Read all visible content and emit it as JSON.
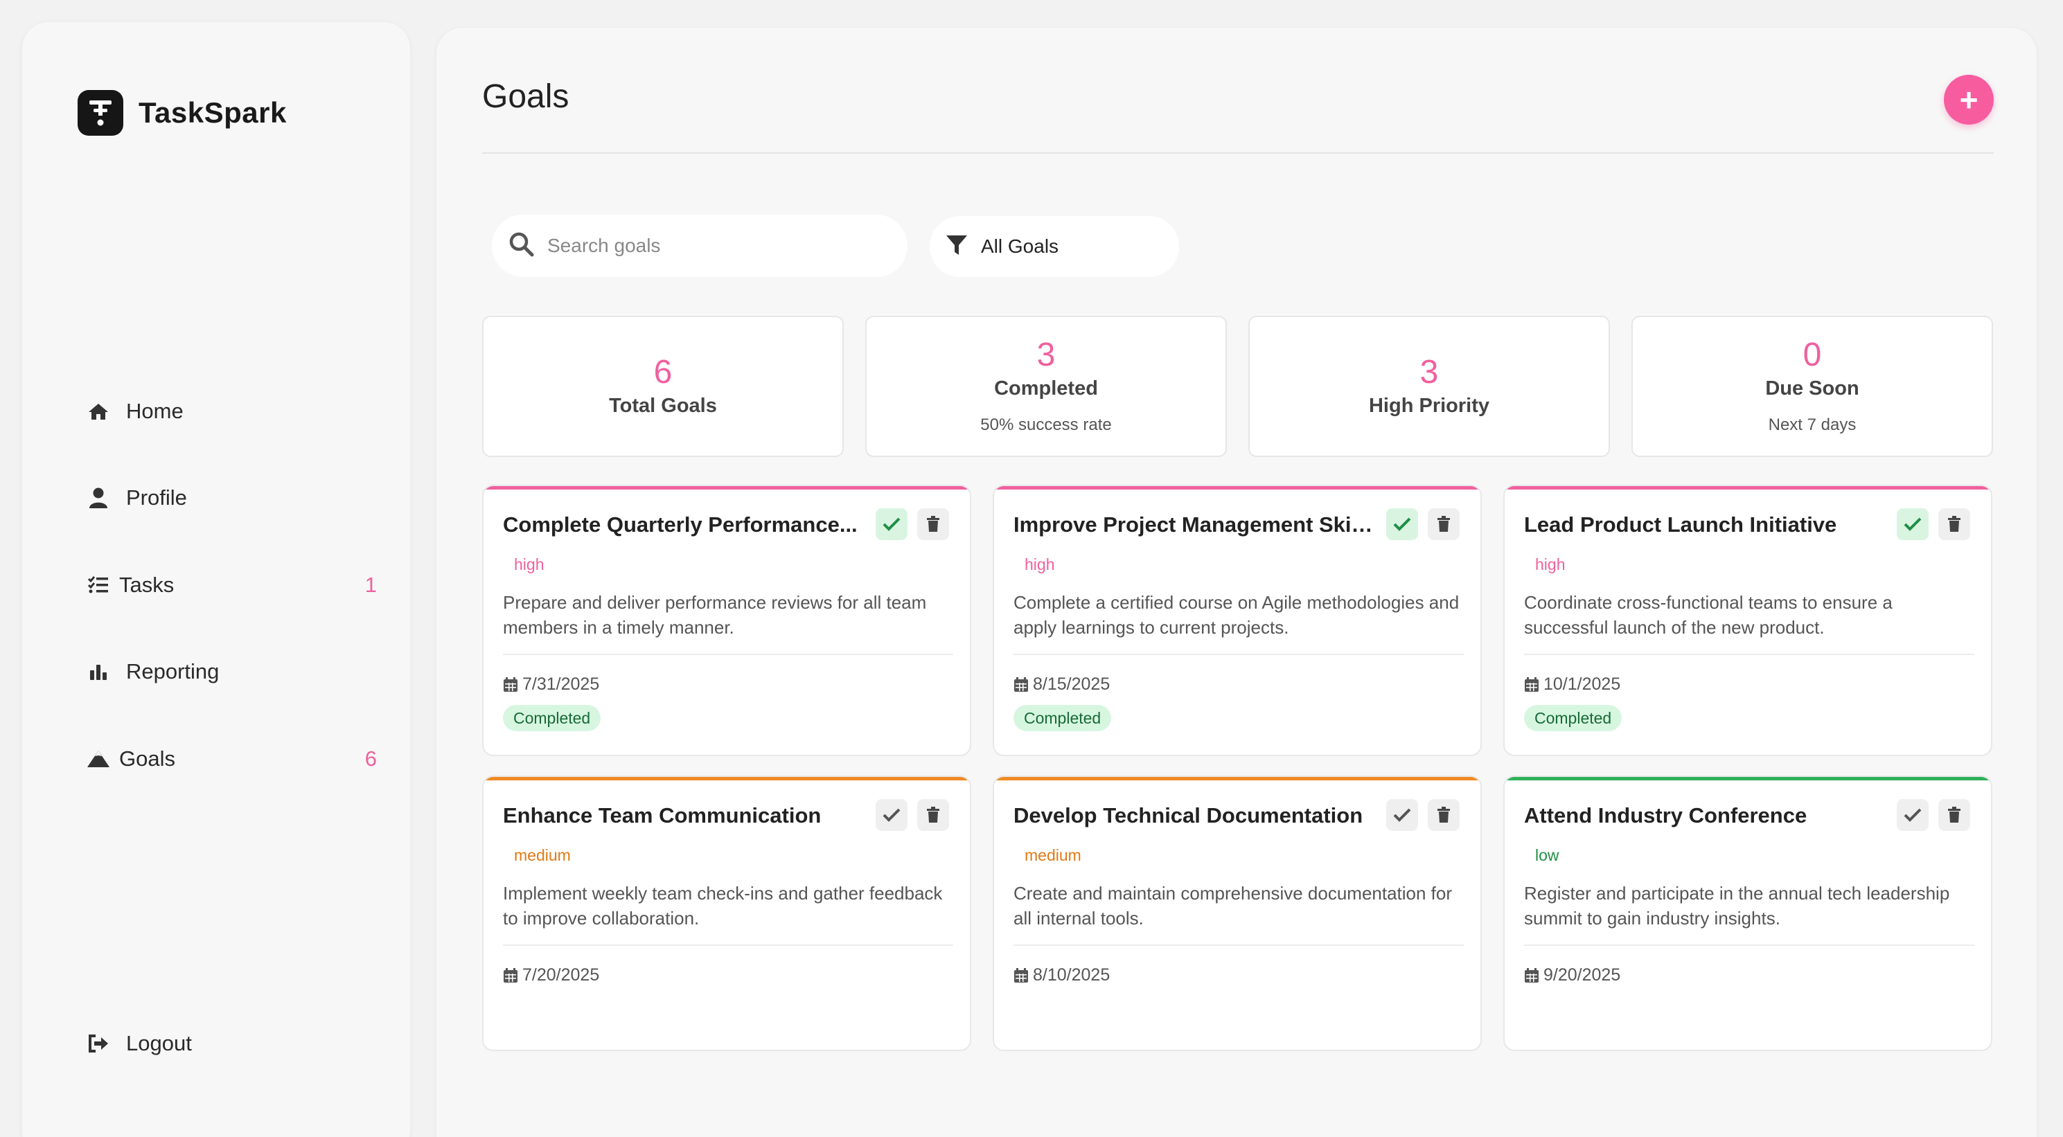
{
  "app": {
    "name": "TaskSpark"
  },
  "sidebar": {
    "items": [
      {
        "label": "Home",
        "icon": "home-icon",
        "count": ""
      },
      {
        "label": "Profile",
        "icon": "user-icon",
        "count": ""
      },
      {
        "label": "Tasks",
        "icon": "list-check-icon",
        "count": "1"
      },
      {
        "label": "Reporting",
        "icon": "bar-chart-icon",
        "count": ""
      },
      {
        "label": "Goals",
        "icon": "mountain-icon",
        "count": "6"
      }
    ],
    "logout": {
      "label": "Logout",
      "icon": "logout-icon"
    }
  },
  "header": {
    "title": "Goals",
    "add_label": "+"
  },
  "search": {
    "placeholder": "Search goals",
    "value": ""
  },
  "filter": {
    "label": "All Goals"
  },
  "stats": [
    {
      "value": "6",
      "label": "Total Goals",
      "sub": ""
    },
    {
      "value": "3",
      "label": "Completed",
      "sub": "50% success rate"
    },
    {
      "value": "3",
      "label": "High Priority",
      "sub": ""
    },
    {
      "value": "0",
      "label": "Due Soon",
      "sub": "Next 7 days"
    }
  ],
  "colors": {
    "accent": "#f0609e",
    "high": "#f0609e",
    "medium": "#f08a24",
    "low": "#2fb05a",
    "completed_bg": "#d7f6e0",
    "completed_text": "#176b37"
  },
  "goals": [
    {
      "title": "Complete Quarterly Performance...",
      "priority": "high",
      "description": "Prepare and deliver performance reviews for all team members in a timely manner.",
      "date": "7/31/2025",
      "status": "Completed",
      "completed": true
    },
    {
      "title": "Improve Project Management Skills",
      "priority": "high",
      "description": "Complete a certified course on Agile methodologies and apply learnings to current projects.",
      "date": "8/15/2025",
      "status": "Completed",
      "completed": true
    },
    {
      "title": "Lead Product Launch Initiative",
      "priority": "high",
      "description": "Coordinate cross-functional teams to ensure a successful launch of the new product.",
      "date": "10/1/2025",
      "status": "Completed",
      "completed": true
    },
    {
      "title": "Enhance Team Communication",
      "priority": "medium",
      "description": "Implement weekly team check-ins and gather feedback to improve collaboration.",
      "date": "7/20/2025",
      "status": "",
      "completed": false
    },
    {
      "title": "Develop Technical Documentation",
      "priority": "medium",
      "description": "Create and maintain comprehensive documentation for all internal tools.",
      "date": "8/10/2025",
      "status": "",
      "completed": false
    },
    {
      "title": "Attend Industry Conference",
      "priority": "low",
      "description": "Register and participate in the annual tech leadership summit to gain industry insights.",
      "date": "9/20/2025",
      "status": "",
      "completed": false
    }
  ]
}
